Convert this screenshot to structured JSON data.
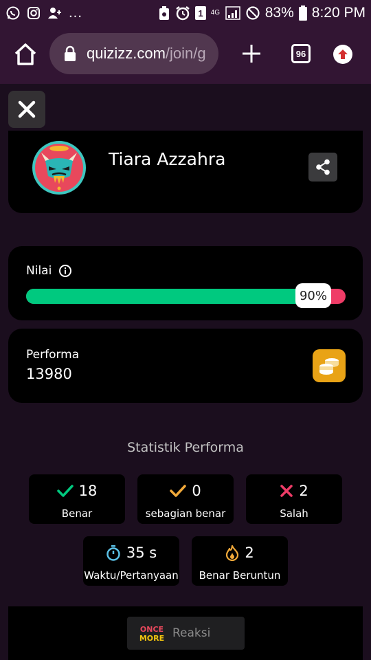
{
  "status_bar": {
    "battery": "83%",
    "time": "8:20 PM",
    "ellipsis": "…",
    "network": "4G"
  },
  "browser": {
    "url_domain": "quizizz.com",
    "url_path": "/join/g",
    "tab_count": "96"
  },
  "profile": {
    "name": "Tiara Azzahra"
  },
  "score": {
    "label": "Nilai",
    "percent_text": "90%",
    "fraction": 0.9
  },
  "performance": {
    "label": "Performa",
    "value": "13980"
  },
  "stats": {
    "title": "Statistik Performa",
    "correct": {
      "value": "18",
      "label": "Benar",
      "color": "#00c97f"
    },
    "partial": {
      "value": "0",
      "label": "sebagian benar",
      "color": "#f1a93a"
    },
    "wrong": {
      "value": "2",
      "label": "Salah",
      "color": "#ef3c67"
    },
    "time": {
      "value": "35 s",
      "label": "Waktu/Pertanyaan",
      "color": "#5bc1e6"
    },
    "streak": {
      "value": "2",
      "label": "Benar Beruntun",
      "color": "#f1a93a"
    }
  },
  "footer": {
    "reaction_label": "Reaksi",
    "logo_text_top": "ONCE",
    "logo_text_bottom": "MORE"
  },
  "colors": {
    "header_bg": "#321533",
    "page_bg": "#1b0e1e",
    "progress_green": "#00c97f",
    "progress_red": "#ef3c67",
    "coin": "#e9a316"
  }
}
